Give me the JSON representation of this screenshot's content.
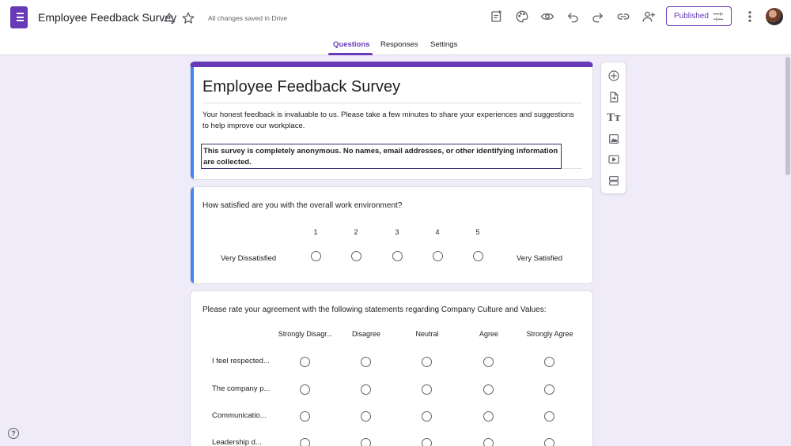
{
  "header": {
    "doc_title": "Employee Feedback Survey",
    "save_status": "All changes saved in Drive",
    "published_label": "Published",
    "icons": [
      "forms-app-icon",
      "move-to-folder-icon",
      "star-icon",
      "customize-theme-icon",
      "palette-icon",
      "preview-eye-icon",
      "undo-icon",
      "redo-icon",
      "link-icon",
      "add-collaborator-icon",
      "publish-settings-icon",
      "more-options-icon",
      "avatar"
    ]
  },
  "tabs": [
    {
      "label": "Questions",
      "active": true
    },
    {
      "label": "Responses",
      "active": false
    },
    {
      "label": "Settings",
      "active": false
    }
  ],
  "form": {
    "title": "Employee Feedback Survey",
    "description": "Your honest feedback is invaluable to us. Please take a few minutes to share your experiences and suggestions to help improve our workplace.",
    "anonymous_note": "This survey is completely anonymous. No names, email addresses, or other identifying information are collected."
  },
  "question1": {
    "text": "How satisfied are you with the overall work environment?",
    "scale": [
      "1",
      "2",
      "3",
      "4",
      "5"
    ],
    "low_label": "Very Dissatisfied",
    "high_label": "Very Satisfied"
  },
  "question2": {
    "text": "Please rate your agreement with the following statements regarding Company Culture and Values:",
    "columns": [
      "Strongly Disagr...",
      "Disagree",
      "Neutral",
      "Agree",
      "Strongly Agree"
    ],
    "rows": [
      "I feel respected...",
      "The company p...",
      "Communicatio...",
      "Leadership d..."
    ]
  },
  "side_toolbar": [
    "add-question-icon",
    "import-questions-icon",
    "add-title-icon",
    "add-image-icon",
    "add-video-icon",
    "add-section-icon"
  ],
  "side_toolbar_text_glyph": "Tт",
  "help_glyph": "?",
  "colors": {
    "accent": "#673ab7",
    "background": "#f0ebf8",
    "focus": "#4285f4"
  }
}
